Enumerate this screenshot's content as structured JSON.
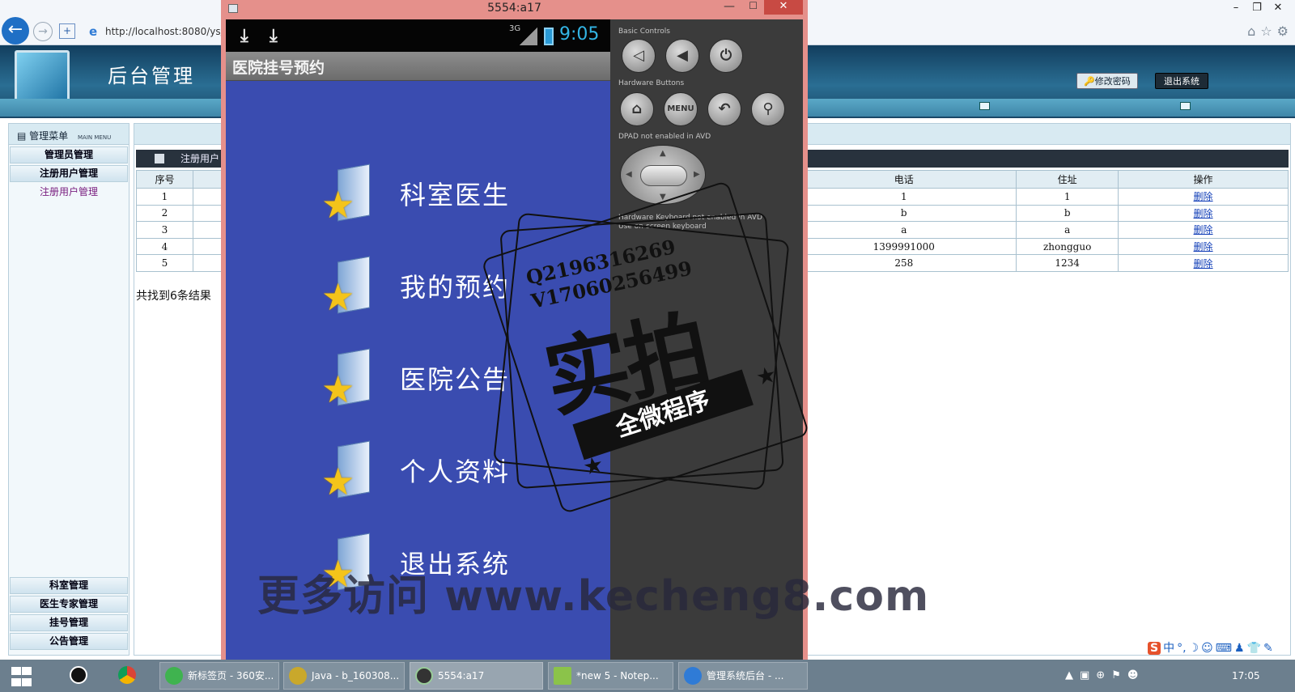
{
  "browser": {
    "url": "http://localhost:8080/ys/",
    "window_controls": [
      "–",
      "❐",
      "✕"
    ]
  },
  "admin": {
    "title": "后台管理",
    "change_password": "修改密码",
    "logout": "退出系统"
  },
  "sidebar": {
    "title": "管理菜单",
    "subtitle": "MAIN MENU",
    "top_items": [
      {
        "label": "管理员管理"
      },
      {
        "label": "注册用户管理"
      }
    ],
    "sub_item": "注册用户管理",
    "bottom_items": [
      {
        "label": "科室管理"
      },
      {
        "label": "医生专家管理"
      },
      {
        "label": "挂号管理"
      },
      {
        "label": "公告管理"
      }
    ]
  },
  "main": {
    "list_title": "注册用户",
    "columns": {
      "no": "序号",
      "phone": "电话",
      "address": "住址",
      "action": "操作"
    },
    "rows": [
      {
        "no": "1",
        "phone": "1",
        "address": "1",
        "action": "删除"
      },
      {
        "no": "2",
        "phone": "b",
        "address": "b",
        "action": "删除"
      },
      {
        "no": "3",
        "phone": "a",
        "address": "a",
        "action": "删除"
      },
      {
        "no": "4",
        "phone": "1399991000",
        "address": "zhongguo",
        "action": "删除"
      },
      {
        "no": "5",
        "phone": "258",
        "address": "1234",
        "action": "删除"
      }
    ],
    "result_count": "共找到6条结果"
  },
  "emulator": {
    "title": "5554:a17",
    "phone": {
      "network": "3G",
      "clock": "9:05",
      "app_title": "医院挂号预约",
      "menu": [
        {
          "label": "科室医生"
        },
        {
          "label": "我的预约"
        },
        {
          "label": "医院公告"
        },
        {
          "label": "个人资料"
        },
        {
          "label": "退出系统"
        }
      ]
    },
    "controls": {
      "basic_controls": "Basic Controls",
      "hardware_buttons": "Hardware Buttons",
      "menu_label": "MENU",
      "dpad_note": "DPAD not enabled in AVD",
      "keyboard_note": "Hardware Keyboard not enabled in AVD",
      "keyboard_note2": "Use on-screen keyboard"
    }
  },
  "watermark": {
    "contact_q": "Q2196316269",
    "contact_v": "V17060256499",
    "big": "实拍",
    "ribbon": "全微程序",
    "bottom": "更多访问 www.kecheng8.com"
  },
  "ime": {
    "items": [
      "S",
      "中",
      "°,",
      "☽",
      "☺",
      "⌨",
      "♟",
      "👕",
      "✎"
    ]
  },
  "taskbar": {
    "buttons": [
      {
        "label": "新标签页 - 360安..."
      },
      {
        "label": "Java - b_160308..."
      },
      {
        "label": "5554:a17"
      },
      {
        "label": "*new 5 - Notep..."
      },
      {
        "label": "管理系统后台 - ..."
      }
    ],
    "clock": "17:05"
  }
}
